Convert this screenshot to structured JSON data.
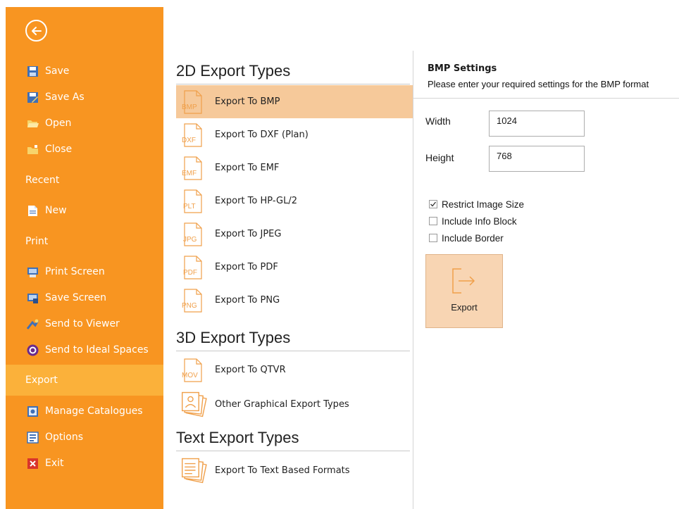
{
  "sidebar": {
    "items": [
      {
        "label": "Save",
        "icon": "save-icon"
      },
      {
        "label": "Save As",
        "icon": "save-as-icon"
      },
      {
        "label": "Open",
        "icon": "open-folder-icon"
      },
      {
        "label": "Close",
        "icon": "close-folder-icon"
      },
      {
        "label": "New",
        "icon": "new-document-icon"
      },
      {
        "label": "Print Screen",
        "icon": "print-screen-icon"
      },
      {
        "label": "Save Screen",
        "icon": "save-screen-icon"
      },
      {
        "label": "Send to Viewer",
        "icon": "send-to-viewer-icon"
      },
      {
        "label": "Send to Ideal Spaces",
        "icon": "ideal-spaces-icon"
      },
      {
        "label": "Manage Catalogues",
        "icon": "catalogue-icon"
      },
      {
        "label": "Options",
        "icon": "options-icon"
      },
      {
        "label": "Exit",
        "icon": "exit-icon"
      }
    ],
    "headers": {
      "recent": "Recent",
      "print": "Print",
      "export": "Export"
    },
    "color": "#f89521",
    "active_color": "#fbb13a"
  },
  "sections": [
    {
      "title": "2D Export Types",
      "items": [
        {
          "label": "Export To BMP",
          "icon_text": "BMP",
          "selected": true
        },
        {
          "label": "Export To DXF (Plan)",
          "icon_text": "DXF"
        },
        {
          "label": "Export To EMF",
          "icon_text": "EMF"
        },
        {
          "label": "Export To HP-GL/2",
          "icon_text": "PLT"
        },
        {
          "label": "Export To JPEG",
          "icon_text": "JPG"
        },
        {
          "label": "Export To PDF",
          "icon_text": "PDF"
        },
        {
          "label": "Export To PNG",
          "icon_text": "PNG"
        }
      ]
    },
    {
      "title": "3D Export Types",
      "items": [
        {
          "label": "Export To QTVR",
          "icon_text": "MOV"
        },
        {
          "label": "Other Graphical Export Types",
          "icon_text": ""
        }
      ]
    },
    {
      "title": "Text Export Types",
      "items": [
        {
          "label": "Export To Text Based Formats",
          "icon_text": ""
        }
      ]
    }
  ],
  "settings": {
    "title": "BMP Settings",
    "description": "Please enter your required settings for the BMP format",
    "width_label": "Width",
    "width_value": "1024",
    "height_label": "Height",
    "height_value": "768",
    "checkboxes": [
      {
        "label": "Restrict Image Size",
        "checked": true
      },
      {
        "label": "Include Info Block",
        "checked": false
      },
      {
        "label": "Include Border",
        "checked": false
      }
    ],
    "export_label": "Export"
  }
}
